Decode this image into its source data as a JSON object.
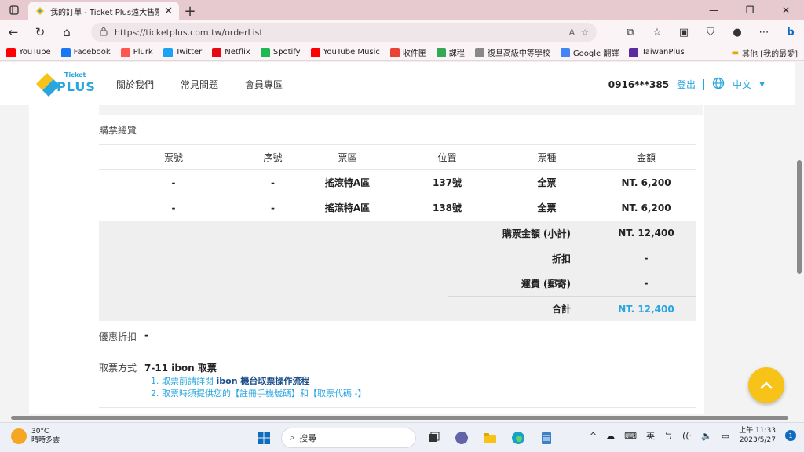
{
  "browser": {
    "tab_title": "我的訂單 - Ticket Plus遠大售票系",
    "url": "https://ticketplus.com.tw/orderList",
    "bookmarks": [
      {
        "label": "YouTube",
        "color": "#ff0000"
      },
      {
        "label": "Facebook",
        "color": "#1877f2"
      },
      {
        "label": "Plurk",
        "color": "#ff574d"
      },
      {
        "label": "Twitter",
        "color": "#1da1f2"
      },
      {
        "label": "Netflix",
        "color": "#e50914"
      },
      {
        "label": "Spotify",
        "color": "#1db954"
      },
      {
        "label": "YouTube Music",
        "color": "#ff0000"
      },
      {
        "label": "收件匣",
        "color": "#ea4335"
      },
      {
        "label": "課程",
        "color": "#34a853"
      },
      {
        "label": "復旦高級中等學校",
        "color": "#888888"
      },
      {
        "label": "Google 翻譯",
        "color": "#4285f4"
      },
      {
        "label": "TaiwanPlus",
        "color": "#5b2ca0"
      }
    ],
    "other_bookmarks": "其他 [我的最愛]"
  },
  "site": {
    "logo_top": "Ticket",
    "logo_main": "PLUS",
    "nav": [
      "關於我們",
      "常見問題",
      "會員專區"
    ],
    "phone": "0916***385",
    "logout": "登出",
    "language": "中文",
    "brand_color": "#2aa6df"
  },
  "order": {
    "section_title": "購票總覽",
    "columns": [
      "票號",
      "序號",
      "票區",
      "位置",
      "票種",
      "金額"
    ],
    "rows": [
      [
        "-",
        "-",
        "搖滾特A區",
        "137號",
        "全票",
        "NT. 6,200"
      ],
      [
        "-",
        "-",
        "搖滾特A區",
        "138號",
        "全票",
        "NT. 6,200"
      ]
    ],
    "summary": [
      {
        "label": "購票金額 (小計)",
        "value": "NT. 12,400"
      },
      {
        "label": "折扣",
        "value": "-"
      },
      {
        "label": "運費 (郵寄)",
        "value": "-"
      }
    ],
    "total": {
      "label": "合計",
      "value": "NT. 12,400"
    },
    "discount_label": "優惠折扣",
    "discount_value": "-",
    "pickup_label": "取票方式",
    "pickup_value": "7-11 ibon 取票",
    "step1_prefix": "1. 取票前請詳閱",
    "step1_link": "ibon 機台取票操作流程",
    "step2": "2. 取票時須提供您的【註冊手機號碼】和【取票代碼 -】"
  },
  "taskbar": {
    "temp": "30°C",
    "weather": "晴時多雲",
    "search_placeholder": "搜尋",
    "ime": "英",
    "time": "上午 11:33",
    "date": "2023/5/27",
    "notifications": "1"
  }
}
